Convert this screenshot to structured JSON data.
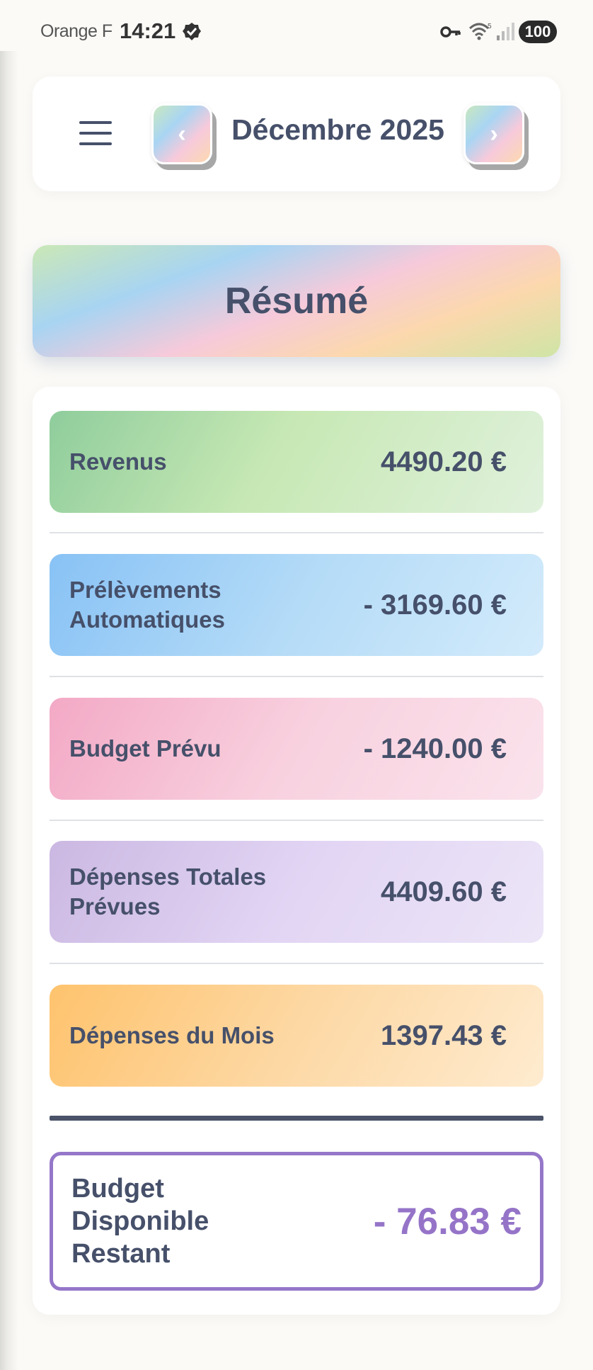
{
  "status_bar": {
    "carrier": "Orange F",
    "time": "14:21",
    "battery": "100"
  },
  "header": {
    "month_title": "Décembre 2025",
    "prev_symbol": "‹",
    "next_symbol": "›"
  },
  "summary": {
    "title": "Résumé",
    "rows": [
      {
        "label": "Revenus",
        "value": "4490.20 €",
        "color": "#8fcd9c"
      },
      {
        "label": "Prélèvements Automatiques",
        "value": "- 3169.60 €",
        "color": "#88c2f5"
      },
      {
        "label": "Budget Prévu",
        "value": "- 1240.00 €",
        "color": "#f3a9c5"
      },
      {
        "label": "Dépenses Totales Prévues",
        "value": "4409.60 €",
        "color": "#cbb8e2"
      },
      {
        "label": "Dépenses du Mois",
        "value": "1397.43 €",
        "color": "#fec36d"
      }
    ],
    "remaining": {
      "label": "Budget Disponible Restant",
      "value": "- 76.83 €",
      "color": "#9574c8"
    }
  },
  "icons": [
    "verified-icon",
    "key-icon",
    "wifi-icon",
    "signal-icon",
    "menu-icon",
    "chevron-left-icon",
    "chevron-right-icon"
  ]
}
